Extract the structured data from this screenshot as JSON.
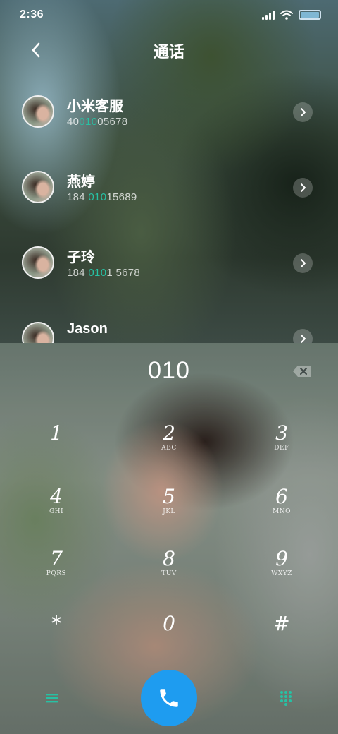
{
  "status_bar": {
    "time": "2:36",
    "battery_color": "#7fb7d3"
  },
  "header": {
    "title": "通话",
    "back_icon": "chevron-left-icon"
  },
  "contacts": [
    {
      "name": "小米客服",
      "number_prefix": "40",
      "number_match": "010",
      "number_suffix": "05678"
    },
    {
      "name": "燕婷",
      "number_prefix": "184 ",
      "number_match": "010",
      "number_suffix": "15689"
    },
    {
      "name": "子玲",
      "number_prefix": "184 ",
      "number_match": "010",
      "number_suffix": "1 5678"
    },
    {
      "name": "Jason",
      "number_prefix": "",
      "number_match": "",
      "number_suffix": ""
    }
  ],
  "highlight_color": "#27c1a4",
  "dialer": {
    "number": "010",
    "delete_icon": "backspace-icon"
  },
  "keypad": [
    {
      "digit": "1",
      "letters": ""
    },
    {
      "digit": "2",
      "letters": "ABC"
    },
    {
      "digit": "3",
      "letters": "DEF"
    },
    {
      "digit": "4",
      "letters": "GHI"
    },
    {
      "digit": "5",
      "letters": "JKL"
    },
    {
      "digit": "6",
      "letters": "MNO"
    },
    {
      "digit": "7",
      "letters": "PQRS"
    },
    {
      "digit": "8",
      "letters": "TUV"
    },
    {
      "digit": "9",
      "letters": "WXYZ"
    },
    {
      "digit": "*",
      "letters": ""
    },
    {
      "digit": "0",
      "letters": ""
    },
    {
      "digit": "#",
      "letters": ""
    }
  ],
  "bottom_bar": {
    "menu_icon": "menu-icon",
    "call_icon": "phone-icon",
    "call_color": "#1e9cf0",
    "keypad_icon": "dialpad-icon"
  }
}
